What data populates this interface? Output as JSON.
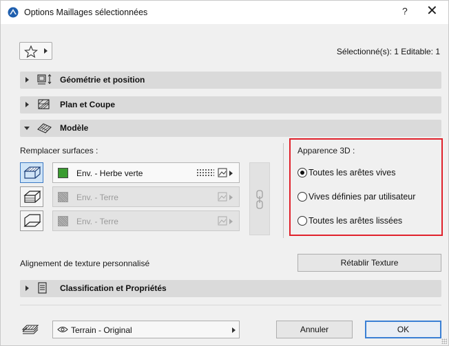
{
  "window": {
    "title": "Options Maillages sélectionnées",
    "help_label": "?",
    "close_label": "✕"
  },
  "header": {
    "selection_info": "Sélectionné(s): 1 Editable: 1",
    "favorites_icon": "star-icon"
  },
  "sections": {
    "geometry": {
      "label": "Géométrie et position",
      "icon": "geometry-icon",
      "expanded": false
    },
    "plan": {
      "label": "Plan et Coupe",
      "icon": "plan-section-icon",
      "expanded": false
    },
    "model": {
      "label": "Modèle",
      "icon": "model-icon",
      "expanded": true
    },
    "classification": {
      "label": "Classification et Propriétés",
      "icon": "document-icon",
      "expanded": false
    }
  },
  "model": {
    "override_label": "Remplacer surfaces :",
    "surfaces": [
      {
        "icon": "top-surface-icon",
        "material": "Env. - Herbe verte",
        "color": "#3b9c31",
        "enabled": true
      },
      {
        "icon": "side-surface-icon",
        "material": "Env. - Terre",
        "color": "#a9a9a9",
        "enabled": false
      },
      {
        "icon": "bottom-surface-icon",
        "material": "Env. - Terre",
        "color": "#a9a9a9",
        "enabled": false
      }
    ],
    "link_icon": "chain-link-icon",
    "appearance": {
      "title": "Apparence 3D :",
      "options": [
        {
          "label": "Toutes les arêtes vives",
          "checked": true
        },
        {
          "label": "Vives définies par utilisateur",
          "checked": false
        },
        {
          "label": "Toutes les arêtes lissées",
          "checked": false
        }
      ],
      "highlight_color": "#e0202a"
    },
    "texture_alignment_label": "Alignement de texture personnalisé",
    "reset_texture_label": "Rétablir Texture"
  },
  "footer": {
    "layer_icon": "layers-icon",
    "layer_name": "Terrain - Original",
    "cancel_label": "Annuler",
    "ok_label": "OK",
    "accent_color": "#3a7fd4"
  }
}
